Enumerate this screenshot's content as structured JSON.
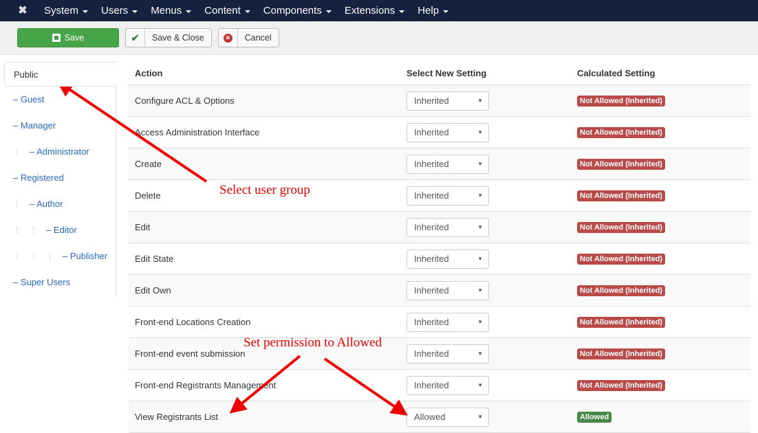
{
  "navbar": {
    "logo": "joomla-logo",
    "items": [
      "System",
      "Users",
      "Menus",
      "Content",
      "Components",
      "Extensions",
      "Help"
    ]
  },
  "toolbar": {
    "save_label": "Save",
    "save_close_label": "Save & Close",
    "cancel_label": "Cancel"
  },
  "sidebar": {
    "active": "Public",
    "items": [
      {
        "label": "– Guest",
        "depth": 0
      },
      {
        "label": "– Manager",
        "depth": 0
      },
      {
        "label": "– Administrator",
        "depth": 1
      },
      {
        "label": "– Registered",
        "depth": 0
      },
      {
        "label": "– Author",
        "depth": 1
      },
      {
        "label": "– Editor",
        "depth": 2
      },
      {
        "label": "– Publisher",
        "depth": 3
      },
      {
        "label": "– Super Users",
        "depth": 0
      }
    ]
  },
  "table": {
    "headers": [
      "Action",
      "Select New Setting",
      "Calculated Setting"
    ],
    "rows": [
      {
        "action": "Configure ACL & Options",
        "setting": "Inherited",
        "calculated": "Not Allowed (Inherited)",
        "status": "deny"
      },
      {
        "action": "Access Administration Interface",
        "setting": "Inherited",
        "calculated": "Not Allowed (Inherited)",
        "status": "deny"
      },
      {
        "action": "Create",
        "setting": "Inherited",
        "calculated": "Not Allowed (Inherited)",
        "status": "deny"
      },
      {
        "action": "Delete",
        "setting": "Inherited",
        "calculated": "Not Allowed (Inherited)",
        "status": "deny"
      },
      {
        "action": "Edit",
        "setting": "Inherited",
        "calculated": "Not Allowed (Inherited)",
        "status": "deny"
      },
      {
        "action": "Edit State",
        "setting": "Inherited",
        "calculated": "Not Allowed (Inherited)",
        "status": "deny"
      },
      {
        "action": "Edit Own",
        "setting": "Inherited",
        "calculated": "Not Allowed (Inherited)",
        "status": "deny"
      },
      {
        "action": "Front-end Locations Creation",
        "setting": "Inherited",
        "calculated": "Not Allowed (Inherited)",
        "status": "deny"
      },
      {
        "action": "Front-end event submission",
        "setting": "Inherited",
        "calculated": "Not Allowed (Inherited)",
        "status": "deny"
      },
      {
        "action": "Front-end Registrants Management",
        "setting": "Inherited",
        "calculated": "Not Allowed (Inherited)",
        "status": "deny"
      },
      {
        "action": "View Registrants List",
        "setting": "Allowed",
        "calculated": "Allowed",
        "status": "allow"
      }
    ]
  },
  "annotations": {
    "select_group": "Select user group",
    "set_permission": "Set permission to Allowed"
  },
  "colors": {
    "navbar": "#14213f",
    "save": "#46a546",
    "deny": "#b94a48",
    "allow": "#468847",
    "link": "#2a69b8",
    "annotation": "#ee0000"
  }
}
